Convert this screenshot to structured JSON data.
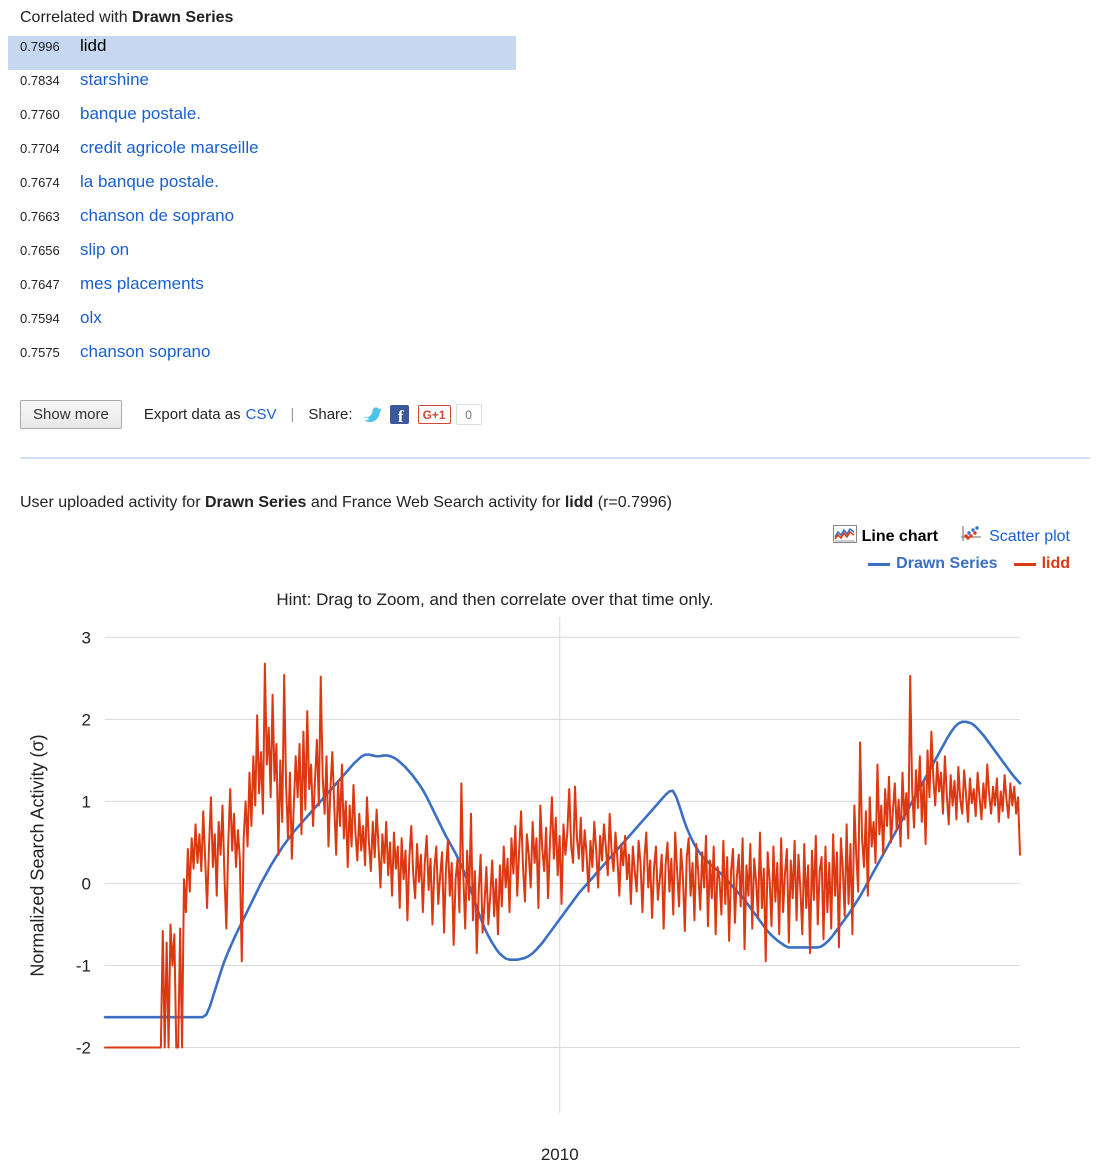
{
  "correlation_panel": {
    "heading_prefix": "Correlated with ",
    "heading_series": "Drawn Series",
    "items": [
      {
        "score": "0.7996",
        "term": "lidd",
        "selected": true
      },
      {
        "score": "0.7834",
        "term": "starshine",
        "selected": false
      },
      {
        "score": "0.7760",
        "term": "banque postale.",
        "selected": false
      },
      {
        "score": "0.7704",
        "term": "credit agricole marseille",
        "selected": false
      },
      {
        "score": "0.7674",
        "term": "la banque postale.",
        "selected": false
      },
      {
        "score": "0.7663",
        "term": "chanson de soprano",
        "selected": false
      },
      {
        "score": "0.7656",
        "term": "slip on",
        "selected": false
      },
      {
        "score": "0.7647",
        "term": "mes placements",
        "selected": false
      },
      {
        "score": "0.7594",
        "term": "olx",
        "selected": false
      },
      {
        "score": "0.7575",
        "term": "chanson soprano",
        "selected": false
      }
    ],
    "selected_bg": "#c6d7f0",
    "link_color": "#1a5fd0"
  },
  "toolbar": {
    "show_more_label": "Show more",
    "export_label": "Export data as",
    "csv_label": "CSV",
    "separator": "|",
    "share_label": "Share:",
    "twitter_icon": "twitter-icon",
    "facebook_icon": "facebook-icon",
    "gplus_label": "G+1",
    "gplus_count": "0"
  },
  "chart_header": {
    "caption_part1": "User uploaded activity for ",
    "caption_series": "Drawn Series",
    "caption_part2": " and France Web Search activity for ",
    "caption_term": "lidd",
    "caption_part3": " (r=0.7996)",
    "line_chart_label": "Line chart",
    "scatter_plot_label": "Scatter plot",
    "line_chart_icon": "line-chart-icon",
    "scatter_plot_icon": "scatter-plot-icon",
    "active_chart_type": "Line chart"
  },
  "chart_data": {
    "type": "line",
    "title": "",
    "hint": "Hint: Drag to Zoom, and then correlate over that time only.",
    "xlabel": "",
    "ylabel": "Normalized Search Activity (σ)",
    "ylim": [
      -2.25,
      3.15
    ],
    "yticks": [
      3,
      2,
      1,
      0,
      -1,
      -2
    ],
    "ytick_labels": [
      "3",
      "2",
      "1",
      "0",
      "-1",
      "-2"
    ],
    "xticks": [
      0.497
    ],
    "xtick_labels": [
      "2010"
    ],
    "grid": true,
    "legend_position": "top-right",
    "series": [
      {
        "name": "Drawn Series",
        "color": "#3a6fc4",
        "values": [
          -1.63,
          -1.63,
          -1.63,
          -1.63,
          -1.63,
          -1.63,
          -1.63,
          -1.63,
          -1.63,
          -1.63,
          -1.63,
          -1.63,
          -1.63,
          -1.63,
          -1.63,
          -1.63,
          -1.63,
          -1.63,
          -1.63,
          -1.63,
          -1.63,
          -1.63,
          -1.63,
          -1.63,
          -1.63,
          -1.63,
          -1.63,
          -1.63,
          -1.6,
          -1.5,
          -1.36,
          -1.22,
          -1.08,
          -0.95,
          -0.84,
          -0.74,
          -0.64,
          -0.55,
          -0.46,
          -0.37,
          -0.28,
          -0.19,
          -0.1,
          -0.01,
          0.07,
          0.15,
          0.23,
          0.3,
          0.37,
          0.44,
          0.5,
          0.56,
          0.62,
          0.67,
          0.72,
          0.77,
          0.82,
          0.87,
          0.92,
          0.97,
          1.02,
          1.07,
          1.12,
          1.17,
          1.22,
          1.27,
          1.32,
          1.37,
          1.42,
          1.47,
          1.51,
          1.55,
          1.57,
          1.57,
          1.56,
          1.55,
          1.55,
          1.56,
          1.56,
          1.55,
          1.53,
          1.5,
          1.46,
          1.42,
          1.37,
          1.32,
          1.26,
          1.2,
          1.13,
          1.05,
          0.96,
          0.87,
          0.78,
          0.69,
          0.6,
          0.52,
          0.44,
          0.36,
          0.27,
          0.17,
          0.06,
          -0.06,
          -0.19,
          -0.32,
          -0.44,
          -0.55,
          -0.64,
          -0.72,
          -0.79,
          -0.85,
          -0.89,
          -0.92,
          -0.93,
          -0.93,
          -0.93,
          -0.92,
          -0.91,
          -0.89,
          -0.86,
          -0.82,
          -0.77,
          -0.72,
          -0.66,
          -0.6,
          -0.54,
          -0.48,
          -0.42,
          -0.36,
          -0.3,
          -0.24,
          -0.18,
          -0.12,
          -0.07,
          -0.02,
          0.03,
          0.08,
          0.13,
          0.18,
          0.23,
          0.28,
          0.33,
          0.38,
          0.43,
          0.48,
          0.53,
          0.58,
          0.63,
          0.68,
          0.73,
          0.78,
          0.83,
          0.88,
          0.93,
          0.98,
          1.03,
          1.08,
          1.12,
          1.13,
          1.05,
          0.92,
          0.78,
          0.66,
          0.56,
          0.47,
          0.4,
          0.34,
          0.29,
          0.25,
          0.21,
          0.17,
          0.13,
          0.09,
          0.04,
          -0.01,
          -0.06,
          -0.11,
          -0.16,
          -0.21,
          -0.27,
          -0.33,
          -0.39,
          -0.45,
          -0.51,
          -0.57,
          -0.62,
          -0.66,
          -0.7,
          -0.73,
          -0.76,
          -0.78,
          -0.78,
          -0.78,
          -0.78,
          -0.78,
          -0.78,
          -0.78,
          -0.78,
          -0.78,
          -0.77,
          -0.74,
          -0.7,
          -0.65,
          -0.59,
          -0.53,
          -0.47,
          -0.41,
          -0.35,
          -0.28,
          -0.21,
          -0.14,
          -0.06,
          0.02,
          0.1,
          0.18,
          0.26,
          0.34,
          0.42,
          0.5,
          0.58,
          0.66,
          0.74,
          0.82,
          0.9,
          0.98,
          1.06,
          1.14,
          1.22,
          1.3,
          1.38,
          1.46,
          1.54,
          1.62,
          1.7,
          1.78,
          1.85,
          1.91,
          1.95,
          1.97,
          1.97,
          1.96,
          1.94,
          1.9,
          1.85,
          1.8,
          1.74,
          1.68,
          1.62,
          1.56,
          1.5,
          1.44,
          1.38,
          1.32,
          1.27,
          1.22
        ]
      },
      {
        "name": "lidd",
        "color": "#dc3912",
        "values": [
          -2.0,
          -2.0,
          -2.0,
          -2.0,
          -2.0,
          -2.0,
          -2.0,
          -2.0,
          -2.0,
          -2.0,
          -2.0,
          -2.0,
          -2.0,
          -2.0,
          -2.0,
          -2.0,
          -2.0,
          -2.0,
          -2.0,
          -2.0,
          -2.0,
          -2.0,
          -2.0,
          -2.0,
          -2.0,
          -2.0,
          -2.0,
          -2.0,
          -2.0,
          -2.0,
          -0.58,
          -2.0,
          -0.72,
          -2.0,
          -0.5,
          -1.0,
          -0.62,
          -2.0,
          -2.0,
          -0.55,
          -2.0,
          0.05,
          -0.35,
          0.42,
          -0.1,
          0.55,
          0.18,
          0.72,
          0.25,
          0.6,
          0.15,
          0.88,
          0.3,
          -0.3,
          0.45,
          1.05,
          0.2,
          0.6,
          -0.15,
          0.75,
          0.35,
          0.95,
          0.1,
          -0.55,
          0.5,
          1.15,
          0.4,
          0.85,
          0.2,
          0.65,
          0.3,
          -0.95,
          0.55,
          1.0,
          0.45,
          1.35,
          0.7,
          1.55,
          0.95,
          2.05,
          1.1,
          1.6,
          0.85,
          2.68,
          1.45,
          1.9,
          1.05,
          2.3,
          1.25,
          1.7,
          0.35,
          1.5,
          0.75,
          2.54,
          1.2,
          0.55,
          1.35,
          0.3,
          0.95,
          1.55,
          1.05,
          1.7,
          0.6,
          1.85,
          0.9,
          2.1,
          1.15,
          1.45,
          0.7,
          1.25,
          1.75,
          0.95,
          2.52,
          1.3,
          0.85,
          1.55,
          0.45,
          1.15,
          1.6,
          0.95,
          0.35,
          1.25,
          0.7,
          1.45,
          0.55,
          1.0,
          0.2,
          0.95,
          0.45,
          1.2,
          0.62,
          0.28,
          0.85,
          0.4,
          0.7,
          0.22,
          1.05,
          0.5,
          0.15,
          0.75,
          0.32,
          0.9,
          0.45,
          -0.05,
          0.6,
          0.25,
          0.75,
          0.1,
          0.5,
          -0.15,
          0.62,
          0.18,
          0.45,
          -0.3,
          0.55,
          0.05,
          0.4,
          -0.45,
          0.32,
          0.7,
          0.12,
          -0.18,
          0.48,
          0.02,
          0.35,
          -0.35,
          0.25,
          0.58,
          -0.08,
          0.3,
          -0.5,
          0.2,
          0.45,
          -0.25,
          0.1,
          0.38,
          -0.6,
          0.18,
          0.52,
          -0.15,
          0.25,
          -0.75,
          0.05,
          0.3,
          -0.35,
          1.22,
          0.1,
          -0.55,
          0.4,
          -0.2,
          0.85,
          -0.45,
          0.15,
          -0.85,
          -0.1,
          0.35,
          -0.6,
          -0.25,
          0.2,
          -0.5,
          -0.15,
          0.28,
          -0.4,
          0.05,
          -0.62,
          0.22,
          -0.28,
          0.45,
          -0.05,
          0.3,
          -0.35,
          0.55,
          0.12,
          0.7,
          -0.15,
          0.4,
          0.88,
          0.2,
          -0.22,
          0.6,
          0.35,
          -0.05,
          0.75,
          0.25,
          0.55,
          -0.3,
          0.95,
          0.42,
          0.15,
          0.68,
          -0.18,
          0.5,
          1.05,
          0.3,
          0.8,
          0.1,
          0.58,
          -0.25,
          0.72,
          0.35,
          0.62,
          1.15,
          0.45,
          0.25,
          1.18,
          0.55,
          0.3,
          0.8,
          0.15,
          0.65,
          0.35,
          -0.1,
          0.52,
          0.2,
          0.75,
          0.4,
          -0.05,
          0.58,
          0.28,
          0.72,
          0.45,
          0.1,
          0.85,
          0.38,
          0.15,
          0.62,
          0.3,
          -0.15,
          0.48,
          0.22,
          0.58,
          0.05,
          0.35,
          -0.25,
          0.45,
          0.15,
          -0.1,
          0.52,
          0.25,
          -0.35,
          0.3,
          0.62,
          -0.05,
          0.28,
          -0.42,
          0.18,
          0.45,
          -0.2,
          0.05,
          0.35,
          -0.55,
          0.22,
          0.5,
          -0.1,
          0.3,
          -0.38,
          0.62,
          0.15,
          -0.28,
          0.42,
          0.08,
          -0.58,
          0.32,
          0.55,
          -0.15,
          0.25,
          -0.45,
          0.48,
          0.12,
          -0.32,
          0.38,
          -0.05,
          0.58,
          -0.52,
          0.28,
          -0.18,
          0.45,
          -0.62,
          0.2,
          0.05,
          -0.38,
          0.52,
          -0.25,
          0.32,
          -0.7,
          0.15,
          0.42,
          -0.48,
          0.08,
          0.35,
          -0.28,
          0.55,
          -0.8,
          0.22,
          -0.15,
          0.48,
          -0.55,
          0.3,
          0.02,
          -0.42,
          0.62,
          -0.3,
          0.18,
          -0.95,
          0.38,
          0.05,
          -0.52,
          0.45,
          -0.22,
          0.25,
          -0.62,
          0.55,
          -0.35,
          0.12,
          0.42,
          -0.72,
          0.28,
          -0.18,
          0.52,
          -0.45,
          0.35,
          -0.08,
          -0.62,
          0.48,
          -0.3,
          0.22,
          -0.85,
          0.4,
          -0.2,
          0.58,
          -0.5,
          0.15,
          0.32,
          -0.68,
          0.45,
          -0.35,
          0.25,
          -0.55,
          0.6,
          -0.15,
          0.38,
          -0.78,
          0.55,
          0.18,
          -0.4,
          0.72,
          -0.25,
          0.48,
          -0.62,
          0.95,
          0.35,
          -0.1,
          1.72,
          0.55,
          0.2,
          0.88,
          -0.15,
          1.05,
          0.45,
          0.75,
          0.25,
          1.45,
          0.6,
          0.95,
          0.35,
          1.15,
          0.7,
          1.3,
          0.5,
          0.88,
          1.22,
          0.65,
          1.02,
          0.45,
          1.35,
          0.78,
          1.1,
          0.55,
          2.53,
          1.15,
          0.68,
          1.38,
          0.92,
          1.55,
          0.75,
          1.25,
          0.48,
          1.62,
          1.05,
          1.85,
          1.28,
          0.95,
          1.48,
          1.12,
          1.35,
          0.85,
          1.55,
          1.08,
          0.72,
          1.32,
          0.95,
          1.25,
          0.78,
          1.42,
          1.02,
          0.85,
          1.38,
          1.08,
          0.75,
          1.28,
          0.98,
          1.15,
          0.82,
          1.35,
          1.05,
          0.78,
          1.22,
          0.92,
          1.45,
          1.08,
          0.85,
          1.18,
          0.95,
          1.28,
          0.75,
          1.12,
          0.88,
          1.32,
          1.02,
          0.8,
          1.22,
          0.95,
          1.18,
          0.85,
          1.05,
          0.35
        ]
      }
    ]
  }
}
